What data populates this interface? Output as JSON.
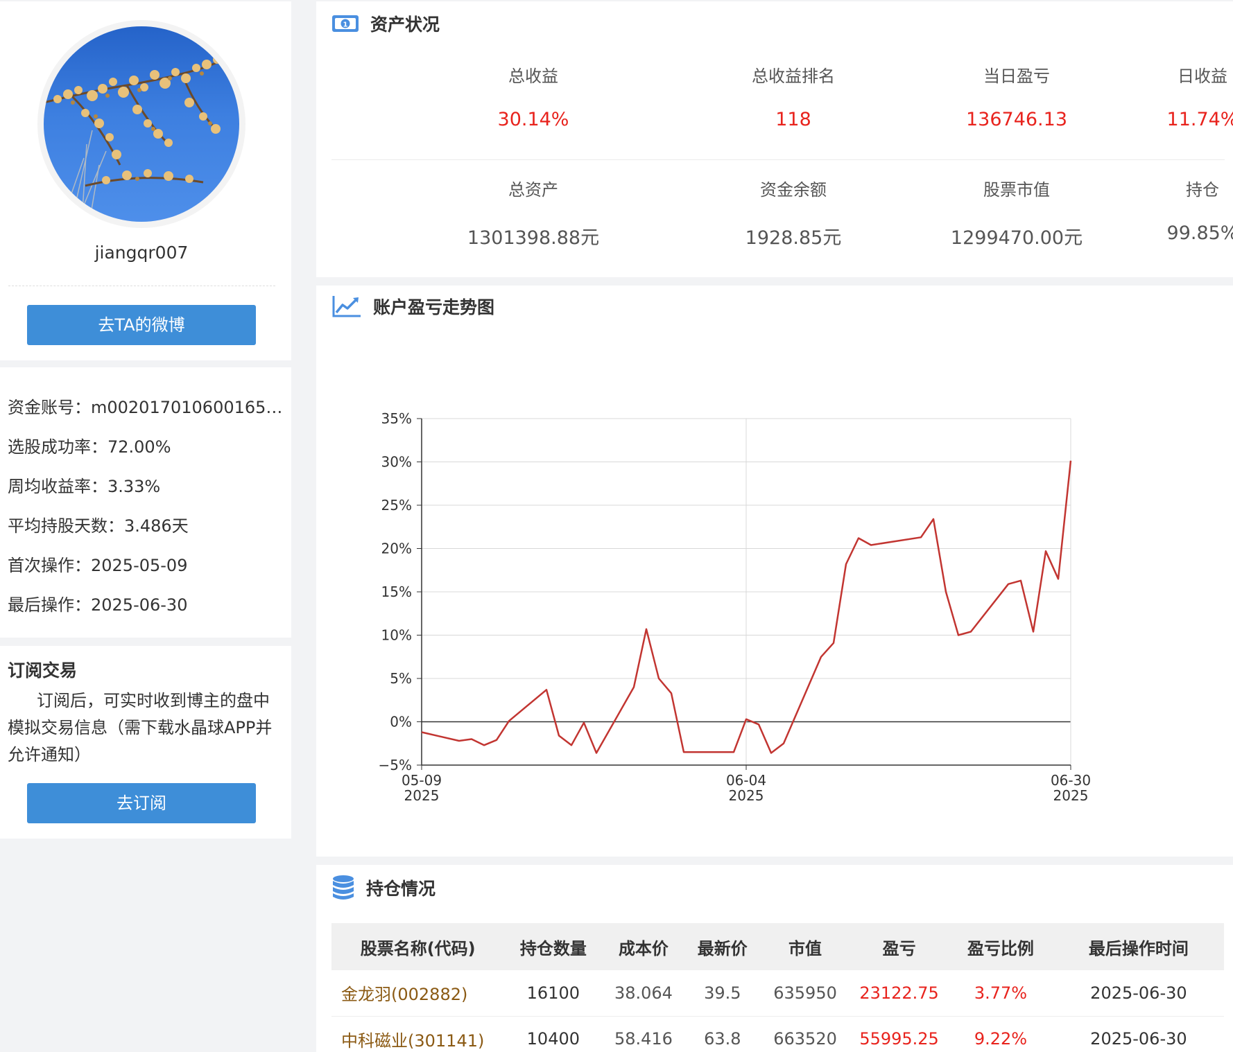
{
  "profile": {
    "username": "jiangqr007",
    "weibo_button": "去TA的微博"
  },
  "account": {
    "fund_account": "资金账号：m002017010600165…",
    "success_rate": "选股成功率：72.00%",
    "weekly_return": "周均收益率：3.33%",
    "avg_hold_days": "平均持股天数：3.486天",
    "first_op": "首次操作：2025-05-09",
    "last_op": "最后操作：2025-06-30"
  },
  "subscribe": {
    "title": "订阅交易",
    "description": "订阅后，可实时收到博主的盘中模拟交易信息（需下载水晶球APP并允许通知）",
    "button": "去订阅"
  },
  "assets": {
    "title": "资产状况",
    "row1": [
      {
        "label": "总收益",
        "value": "30.14%"
      },
      {
        "label": "总收益排名",
        "value": "118"
      },
      {
        "label": "当日盈亏",
        "value": "136746.13"
      },
      {
        "label": "日收益",
        "value": "11.74%"
      }
    ],
    "row2": [
      {
        "label": "总资产",
        "value": "1301398.88元"
      },
      {
        "label": "资金余额",
        "value": "1928.85元"
      },
      {
        "label": "股票市值",
        "value": "1299470.00元"
      },
      {
        "label": "持仓",
        "value": "99.85%"
      }
    ],
    "colors": {
      "positive": "#e8231d",
      "neutral": "#555555"
    }
  },
  "trend": {
    "title": "账户盈亏走势图"
  },
  "chart_data": {
    "type": "line",
    "x_ticks": [
      {
        "date": "2025-05-09",
        "label_top": "05-09",
        "label_bottom": "2025"
      },
      {
        "date": "2025-06-04",
        "label_top": "06-04",
        "label_bottom": "2025"
      },
      {
        "date": "2025-06-30",
        "label_top": "06-30",
        "label_bottom": "2025"
      }
    ],
    "y_ticks": [
      "35%",
      "30%",
      "25%",
      "20%",
      "15%",
      "10%",
      "5%",
      "0%",
      "−5%"
    ],
    "ylim": [
      -5,
      35
    ],
    "xlim": [
      "2025-05-09",
      "2025-06-30"
    ],
    "grid": true,
    "line_color": "#c23531",
    "series": [
      {
        "points": [
          [
            "2025-05-09",
            -1.2
          ],
          [
            "2025-05-12",
            -2.2
          ],
          [
            "2025-05-13",
            -2.0
          ],
          [
            "2025-05-14",
            -2.7
          ],
          [
            "2025-05-15",
            -2.1
          ],
          [
            "2025-05-16",
            0.1
          ],
          [
            "2025-05-19",
            3.7
          ],
          [
            "2025-05-20",
            -1.6
          ],
          [
            "2025-05-21",
            -2.7
          ],
          [
            "2025-05-22",
            -0.1
          ],
          [
            "2025-05-23",
            -3.6
          ],
          [
            "2025-05-26",
            4.0
          ],
          [
            "2025-05-27",
            10.7
          ],
          [
            "2025-05-28",
            5.0
          ],
          [
            "2025-05-29",
            3.3
          ],
          [
            "2025-05-30",
            -3.5
          ],
          [
            "2025-06-03",
            -3.5
          ],
          [
            "2025-06-04",
            0.3
          ],
          [
            "2025-06-05",
            -0.3
          ],
          [
            "2025-06-06",
            -3.6
          ],
          [
            "2025-06-07",
            -2.5
          ],
          [
            "2025-06-10",
            7.5
          ],
          [
            "2025-06-11",
            9.1
          ],
          [
            "2025-06-12",
            18.2
          ],
          [
            "2025-06-13",
            21.2
          ],
          [
            "2025-06-14",
            20.4
          ],
          [
            "2025-06-18",
            21.3
          ],
          [
            "2025-06-19",
            23.4
          ],
          [
            "2025-06-20",
            15.0
          ],
          [
            "2025-06-21",
            10.0
          ],
          [
            "2025-06-22",
            10.4
          ],
          [
            "2025-06-25",
            15.9
          ],
          [
            "2025-06-26",
            16.3
          ],
          [
            "2025-06-27",
            10.4
          ],
          [
            "2025-06-28",
            19.7
          ],
          [
            "2025-06-29",
            16.5
          ],
          [
            "2025-06-30",
            30.14
          ]
        ]
      }
    ]
  },
  "positions": {
    "title": "持仓情况",
    "columns": [
      "股票名称(代码)",
      "持仓数量",
      "成本价",
      "最新价",
      "市值",
      "盈亏",
      "盈亏比例",
      "最后操作时间"
    ],
    "rows": [
      [
        "金龙羽(002882)",
        "16100",
        "38.064",
        "39.5",
        "635950",
        "23122.75",
        "3.77%",
        "2025-06-30"
      ],
      [
        "中科磁业(301141)",
        "10400",
        "58.416",
        "63.8",
        "663520",
        "55995.25",
        "9.22%",
        "2025-06-30"
      ]
    ]
  }
}
